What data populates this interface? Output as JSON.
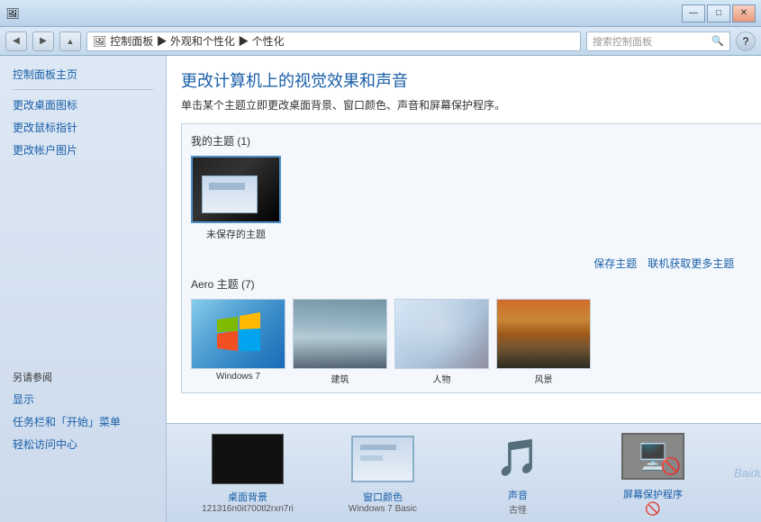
{
  "titlebar": {
    "minimize": "—",
    "maximize": "□",
    "close": "✕"
  },
  "addressbar": {
    "path": "控制面板 ▶ 外观和个性化 ▶ 个性化",
    "search_placeholder": "搜索控制面板",
    "back_icon": "◀",
    "forward_icon": "▶",
    "app_icon": "🖼"
  },
  "sidebar": {
    "home_link": "控制面板主页",
    "links": [
      "更改桌面图标",
      "更改鼠标指针",
      "更改帐户图片"
    ],
    "also_see": "另请参阅",
    "also_see_links": [
      "显示",
      "任务栏和「开始」菜单",
      "轻松访问中心"
    ]
  },
  "content": {
    "title": "更改计算机上的视觉效果和声音",
    "description": "单击某个主题立即更改桌面背景、窗口颜色、声音和屏幕保护程序。",
    "my_themes_label": "我的主题 (1)",
    "unsaved_theme_label": "未保存的主题",
    "save_theme_link": "保存主题",
    "get_more_themes_link": "联机获取更多主题",
    "aero_themes_label": "Aero 主题 (7)",
    "aero_themes": [
      {
        "label": "Windows 7"
      },
      {
        "label": "建筑"
      },
      {
        "label": "人物"
      },
      {
        "label": "风景"
      }
    ]
  },
  "bottombar": {
    "items": [
      {
        "label": "桌面背景",
        "sublabel": "121316n0it700tl2rxn7ri"
      },
      {
        "label": "窗口颜色",
        "sublabel": "Windows 7 Basic"
      },
      {
        "label": "声音",
        "sublabel": "古怪"
      },
      {
        "label": "屏幕保护程序",
        "sublabel": ""
      }
    ]
  }
}
